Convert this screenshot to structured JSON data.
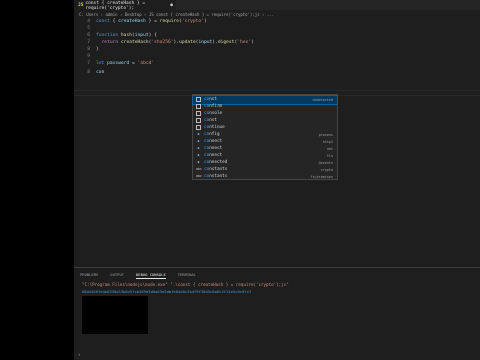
{
  "tab": {
    "icon": "JS",
    "label": "const { createHash } = require('crypto');",
    "close": "●"
  },
  "breadcrumb": "C: Users › admin › Desktop › JS const { createHash } = require('crypto');js › ...",
  "lines": [
    {
      "n": "4",
      "tokens": [
        [
          "kw",
          "const "
        ],
        [
          "pn",
          "{ "
        ],
        [
          "var",
          "createHash"
        ],
        [
          "pn",
          " } = "
        ],
        [
          "fn",
          "require"
        ],
        [
          "pn",
          "("
        ],
        [
          "str",
          "'crypto'"
        ],
        [
          "pn",
          ")"
        ]
      ]
    },
    {
      "n": "5",
      "tokens": []
    },
    {
      "n": "6",
      "tokens": [
        [
          "kw",
          "function "
        ],
        [
          "fn",
          "hash"
        ],
        [
          "pn",
          "("
        ],
        [
          "var",
          "input"
        ],
        [
          "pn",
          ") {"
        ]
      ]
    },
    {
      "n": "7",
      "tokens": [
        [
          "ctl",
          "  return "
        ],
        [
          "fn",
          "createHash"
        ],
        [
          "pn",
          "("
        ],
        [
          "str",
          "'sha256'"
        ],
        [
          "pn",
          ")."
        ],
        [
          "fn",
          "update"
        ],
        [
          "pn",
          "("
        ],
        [
          "var",
          "input"
        ],
        [
          "pn",
          ")."
        ],
        [
          "fn",
          "digest"
        ],
        [
          "pn",
          "("
        ],
        [
          "str",
          "'hex'"
        ],
        [
          "pn",
          ")"
        ]
      ]
    },
    {
      "n": "8",
      "tokens": [
        [
          "pn",
          "}"
        ]
      ]
    },
    {
      "n": "9",
      "tokens": []
    },
    {
      "n": "7",
      "tokens": [
        [
          "kw",
          "let "
        ],
        [
          "var",
          "password"
        ],
        [
          "pn",
          " = "
        ],
        [
          "str",
          "'abcd'"
        ]
      ]
    },
    {
      "n": "8",
      "tokens": [
        [
          "var",
          "co"
        ],
        [
          "pn",
          "n"
        ]
      ]
    }
  ],
  "suggestions": [
    {
      "icon": "box",
      "glyph": "",
      "match": "co",
      "rest": "nst",
      "detail": "Undetected",
      "selected": true
    },
    {
      "icon": "box",
      "glyph": "",
      "match": "co",
      "rest": "nfirm",
      "detail": "",
      "selected": false
    },
    {
      "icon": "box",
      "glyph": "",
      "match": "co",
      "rest": "nsole",
      "detail": "",
      "selected": false
    },
    {
      "icon": "box",
      "glyph": "",
      "match": "co",
      "rest": "nst",
      "detail": "",
      "selected": false
    },
    {
      "icon": "box",
      "glyph": "",
      "match": "co",
      "rest": "ntinue",
      "detail": "",
      "selected": false
    },
    {
      "icon": "var",
      "glyph": "◆",
      "match": "co",
      "rest": "nfig",
      "detail": "process",
      "selected": false
    },
    {
      "icon": "var",
      "glyph": "◆",
      "match": "co",
      "rest": "nnect",
      "detail": "http2",
      "selected": false
    },
    {
      "icon": "var",
      "glyph": "◆",
      "match": "co",
      "rest": "nnect",
      "detail": "net",
      "selected": false
    },
    {
      "icon": "var",
      "glyph": "◆",
      "match": "co",
      "rest": "nnect",
      "detail": "tls",
      "selected": false
    },
    {
      "icon": "var",
      "glyph": "◆",
      "match": "co",
      "rest": "nnected",
      "detail": "@events",
      "selected": false
    },
    {
      "icon": "txt",
      "glyph": "abc",
      "match": "co",
      "rest": "nstants",
      "detail": "crypto",
      "selected": false
    },
    {
      "icon": "txt",
      "glyph": "abc",
      "match": "co",
      "rest": "nstants",
      "detail": "fs/promises",
      "selected": false
    }
  ],
  "panel": {
    "tabs": [
      "PROBLEMS",
      "OUTPUT",
      "DEBUG CONSOLE",
      "TERMINAL"
    ],
    "active_tab": "DEBUG CONSOLE",
    "command": "\"C:\\Program Files\\nodejs\\node.exe\" \".\\const { createHash } = require('crypto');js\"",
    "output": "88d4266fd4e6338d13b845fcb289d3d8a63e5dbfe04d8c3b4f9f38d5c8a6c2f14e5c0c0fc3",
    "prompt": "›"
  },
  "colors": {
    "editor_bg": "#1e1e1e",
    "panel_bg": "#1e1e1e",
    "selection": "#04395e",
    "accent": "#0e639c"
  }
}
